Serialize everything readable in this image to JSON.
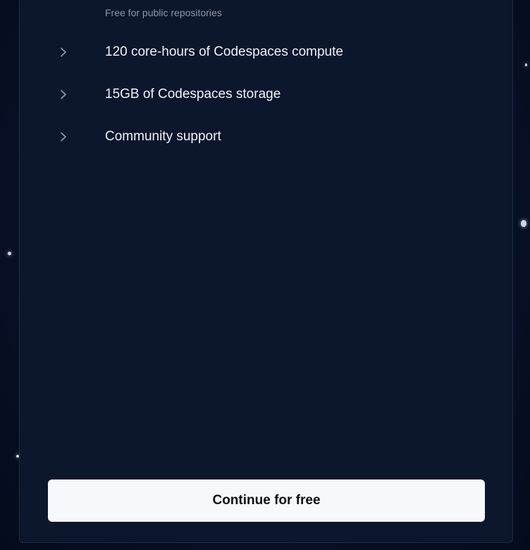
{
  "plan_features": {
    "partial_item": {
      "title": "",
      "subtext": "Free for public repositories"
    },
    "items": [
      {
        "label": "120 core-hours of Codespaces compute",
        "icon": "chevron-right-icon"
      },
      {
        "label": "15GB of Codespaces storage",
        "icon": "chevron-right-icon"
      },
      {
        "label": "Community support",
        "icon": "chevron-right-icon"
      }
    ]
  },
  "cta": {
    "label": "Continue for free"
  },
  "colors": {
    "background": "#071127",
    "card": "#0c172e",
    "button": "#f6f8fb",
    "button_text": "#0d1117",
    "muted_text": "#8b96ab"
  }
}
